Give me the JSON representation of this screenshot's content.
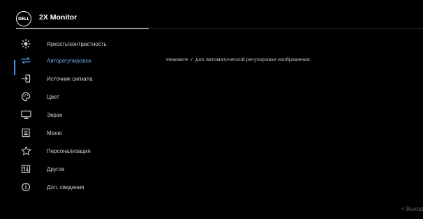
{
  "header": {
    "logo_text": "DELL",
    "title": "2X Monitor"
  },
  "menu": {
    "active_index": 1,
    "items": [
      {
        "label": "Яркость/контрастность",
        "icon": "brightness-icon"
      },
      {
        "label": "Авторегулировка",
        "icon": "auto-adjust-icon"
      },
      {
        "label": "Источник сигнала",
        "icon": "input-source-icon"
      },
      {
        "label": "Цвет",
        "icon": "color-palette-icon"
      },
      {
        "label": "Экран",
        "icon": "display-monitor-icon"
      },
      {
        "label": "Меню",
        "icon": "menu-document-icon"
      },
      {
        "label": "Персонализация",
        "icon": "star-icon"
      },
      {
        "label": "Другое",
        "icon": "other-settings-icon"
      },
      {
        "label": "Доп. сведения",
        "icon": "info-icon"
      }
    ]
  },
  "content": {
    "description": "Нажмите ✓ для автоматической регулировки изображения."
  },
  "footer": {
    "exit_label": "< Выход"
  },
  "colors": {
    "background": "#000000",
    "accent": "#4d94e0",
    "active_text": "#6aa7e8",
    "text": "#cfcfcf"
  }
}
